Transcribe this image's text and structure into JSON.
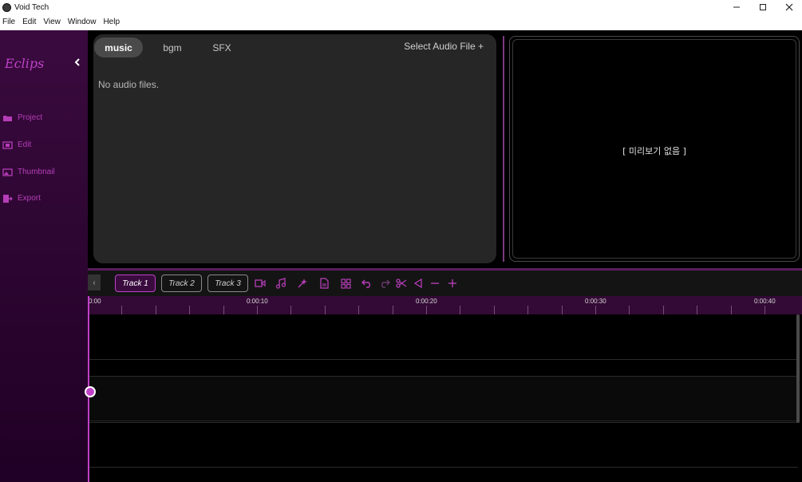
{
  "window": {
    "title": "Void Tech",
    "controls": [
      "—",
      "☐",
      "✕"
    ]
  },
  "menu": [
    "File",
    "Edit",
    "View",
    "Window",
    "Help"
  ],
  "sidebar": {
    "brand": "Eclips",
    "collapse_icon": "chevron-left-icon",
    "items": [
      {
        "label": "Project",
        "icon": "folder-icon"
      },
      {
        "label": "Edit",
        "icon": "film-icon"
      },
      {
        "label": "Thumbnail",
        "icon": "image-icon"
      },
      {
        "label": "Export",
        "icon": "export-icon"
      }
    ]
  },
  "audio_panel": {
    "tabs": [
      "music",
      "bgm",
      "SFX"
    ],
    "active_tab": "music",
    "select_label": "Select Audio File +",
    "empty_text": "No audio files."
  },
  "preview": {
    "empty_text": "[ 미리보기 없음 ]"
  },
  "timeline": {
    "tracks": [
      "Track 1",
      "Track 2",
      "Track 3"
    ],
    "active_track": "Track 1",
    "tools": [
      "video-icon",
      "music-note-icon",
      "magic-icon",
      "document-icon",
      "grid-icon",
      "undo-icon",
      "redo-icon",
      "scissors-icon",
      "split-left-icon",
      "zoom-out-icon",
      "zoom-in-icon"
    ],
    "ruler_labels": [
      "0:00",
      "0:00:10",
      "0:00:20",
      "0:00:30",
      "0:00:40"
    ],
    "playhead_time": "0:00"
  },
  "colors": {
    "accent": "#c040c8",
    "sidebar": "#2f0733",
    "ruler": "#330a35",
    "panel": "#262626"
  }
}
